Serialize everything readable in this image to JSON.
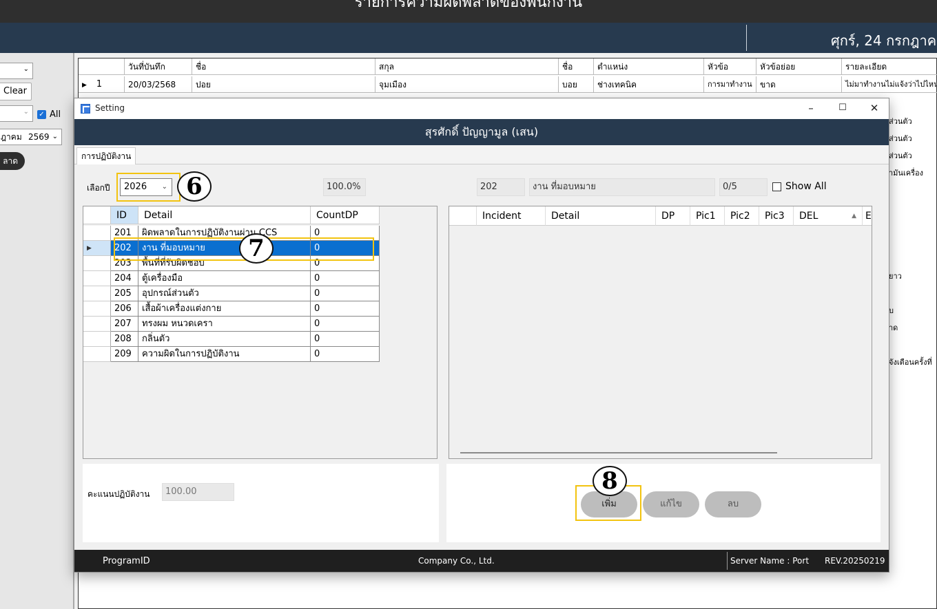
{
  "background": {
    "title": "รายการความผิดพลาดของพนักงาน",
    "date": "ศุกร์, 24 กรกฎาค",
    "left": {
      "clear_label": "Clear",
      "all_label": "All",
      "month_partial": "ฎาคม",
      "year": "2569",
      "dark_btn_label": "ลาด"
    },
    "grid": {
      "columns": [
        "วันที่บันทึก",
        "ชื่อ",
        "สกุล",
        "ชื่อ",
        "ตำแหน่ง",
        "หัวข้อ",
        "หัวข้อย่อย",
        "รายละเอียด"
      ],
      "row1": {
        "index": "1",
        "date": "20/03/2568",
        "first_name": "ปอย",
        "last_name": "จุมเมือง",
        "nickname": "บอย",
        "position": "ช่างเทคนิค",
        "topic": "การมาทำงาน",
        "subtopic": "ขาด",
        "detail": "ไม่มาทำงานไม่แจ้งว่าไปไหน"
      },
      "right_fragments": [
        "ส่วนตัว",
        "ส่วนตัว",
        "ส่วนตัว",
        "ามันเครื่อง",
        "ยาว",
        "บ",
        "าด",
        "จังเตือนครั้งที่"
      ]
    }
  },
  "dialog": {
    "window_title": "Setting",
    "header": "สุรศักดิ์ ปัญญามูล (เสน)",
    "tab": "การปฏิบัติงาน",
    "year_label": "เลือกปี",
    "year_value": "2026",
    "percent": "100.0%",
    "selected_id": "202",
    "selected_detail": "งาน ที่มอบหมาย",
    "ratio": "0/5",
    "show_all_label": "Show All",
    "left_grid": {
      "headers": [
        "ID",
        "Detail",
        "CountDP"
      ],
      "rows": [
        {
          "id": "201",
          "detail": "ผิดพลาดในการปฏิบัติงานผ่าน CCS",
          "count": "0"
        },
        {
          "id": "202",
          "detail": "งาน ที่มอบหมาย",
          "count": "0"
        },
        {
          "id": "203",
          "detail": "พื้นที่ที่รับผิดชอบ",
          "count": "0"
        },
        {
          "id": "204",
          "detail": "ตู้เครื่องมือ",
          "count": "0"
        },
        {
          "id": "205",
          "detail": "อุปกรณ์ส่วนตัว",
          "count": "0"
        },
        {
          "id": "206",
          "detail": "เสื้อผ้าเครื่องแต่งกาย",
          "count": "0"
        },
        {
          "id": "207",
          "detail": "ทรงผม หนวดเครา",
          "count": "0"
        },
        {
          "id": "208",
          "detail": "กลิ่นตัว",
          "count": "0"
        },
        {
          "id": "209",
          "detail": "ความผิดในการปฏิบัติงาน",
          "count": "0"
        }
      ]
    },
    "right_grid": {
      "headers": [
        "Incident",
        "Detail",
        "DP",
        "Pic1",
        "Pic2",
        "Pic3",
        "DEL",
        "E"
      ]
    },
    "score_label": "คะแนนปฏิบัติงาน",
    "score_value": "100.00",
    "buttons": {
      "add": "เพิ่ม",
      "edit": "แก้ไข",
      "delete": "ลบ"
    },
    "status": {
      "program": "ProgramID",
      "company": "Company Co., Ltd.",
      "server": "Server Name : Port",
      "rev": "REV.20250219"
    }
  },
  "annotations": {
    "a6": "6",
    "a7": "7",
    "a8": "8"
  },
  "colors": {
    "header_navy": "#273a4f",
    "selection_blue": "#0a6fd0",
    "highlight_yellow": "#f2c30f",
    "status_bar": "#1f1f1f"
  }
}
